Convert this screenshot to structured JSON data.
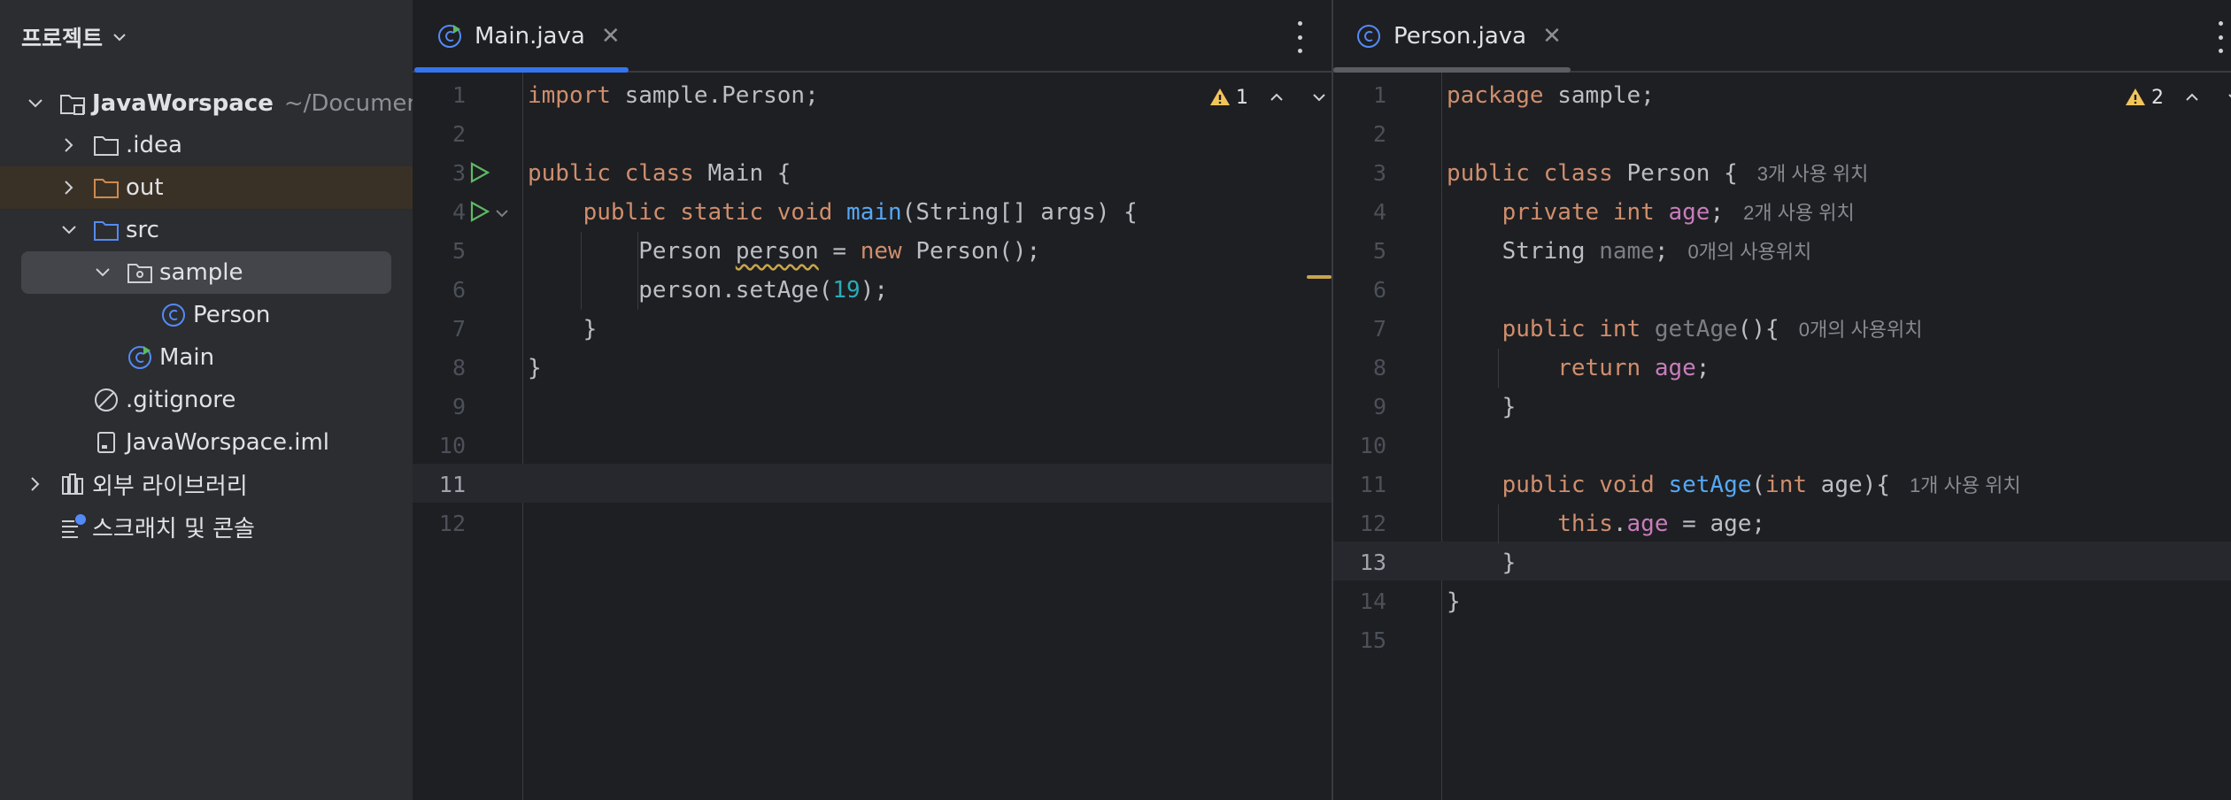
{
  "sidebar": {
    "title": "프로젝트",
    "tree": [
      {
        "label": "JavaWorspace",
        "path": "~/Documents,"
      },
      {
        "label": ".idea"
      },
      {
        "label": "out"
      },
      {
        "label": "src"
      },
      {
        "label": "sample"
      },
      {
        "label": "Person"
      },
      {
        "label": "Main"
      },
      {
        "label": ".gitignore"
      },
      {
        "label": "JavaWorspace.iml"
      },
      {
        "label": "외부 라이브러리"
      },
      {
        "label": "스크래치 및 콘솔"
      }
    ]
  },
  "left_editor": {
    "tab": {
      "label": "Main.java"
    },
    "warnings": "1",
    "current_line": 11,
    "line_numbers": [
      "1",
      "2",
      "3",
      "4",
      "5",
      "6",
      "7",
      "8",
      "9",
      "10",
      "11",
      "12"
    ],
    "code": {
      "l1_kw": "import",
      "l1_rest": " sample.Person;",
      "l3_kw": "public class",
      "l3_rest": " Main {",
      "l4_kw": "public static void",
      "l4_fn": "main",
      "l4_rest": "(String[] args) {",
      "l5_a": "Person ",
      "l5_var": "person",
      "l5_b": " = ",
      "l5_kw": "new",
      "l5_c": " Person();",
      "l6_a": "person.setAge(",
      "l6_num": "19",
      "l6_b": ");",
      "l7": "}",
      "l8": "}"
    }
  },
  "right_editor": {
    "tab": {
      "label": "Person.java"
    },
    "warnings": "2",
    "current_line": 13,
    "line_numbers": [
      "1",
      "2",
      "3",
      "4",
      "5",
      "6",
      "7",
      "8",
      "9",
      "10",
      "11",
      "12",
      "13",
      "14",
      "15"
    ],
    "code": {
      "l1_kw": "package",
      "l1_rest": " sample;",
      "l3_kw": "public class",
      "l3_rest": " Person {",
      "l3_hint": "3개 사용 위치",
      "l4_kw": "private int",
      "l4_fld": "age",
      "l4_rest": ";",
      "l4_hint": "2개 사용 위치",
      "l5_a": "String ",
      "l5_fld": "name",
      "l5_rest": ";",
      "l5_hint": "0개의 사용위치",
      "l7_kw": "public int",
      "l7_fn": "getAge",
      "l7_rest": "(){",
      "l7_hint": "0개의 사용위치",
      "l8_kw": "return",
      "l8_fld": "age",
      "l8_rest": ";",
      "l9": "}",
      "l11_kw": "public void",
      "l11_fn": "setAge",
      "l11_p1": "(",
      "l11_kw2": "int",
      "l11_p2": " age){",
      "l11_hint": "1개 사용 위치",
      "l12_kw": "this",
      "l12_dot": ".",
      "l12_fld": "age",
      "l12_rest": " = age;",
      "l13": "}",
      "l14": "}"
    }
  },
  "colors": {
    "background": "#1e1f22",
    "sidebar": "#2b2d30",
    "keyword": "#cf8e6d",
    "function": "#56a8f5",
    "number": "#2aacb8",
    "field": "#c77dbb",
    "accent_tab": "#3574f0"
  },
  "icons": [
    "chevron-down-icon",
    "chevron-right-icon",
    "module-folder-icon",
    "folder-icon",
    "package-icon",
    "class-icon",
    "main-class-icon",
    "ignore-file-icon",
    "iml-file-icon",
    "library-icon",
    "scratch-icon",
    "warning-icon",
    "run-icon",
    "close-icon",
    "more-icon"
  ]
}
